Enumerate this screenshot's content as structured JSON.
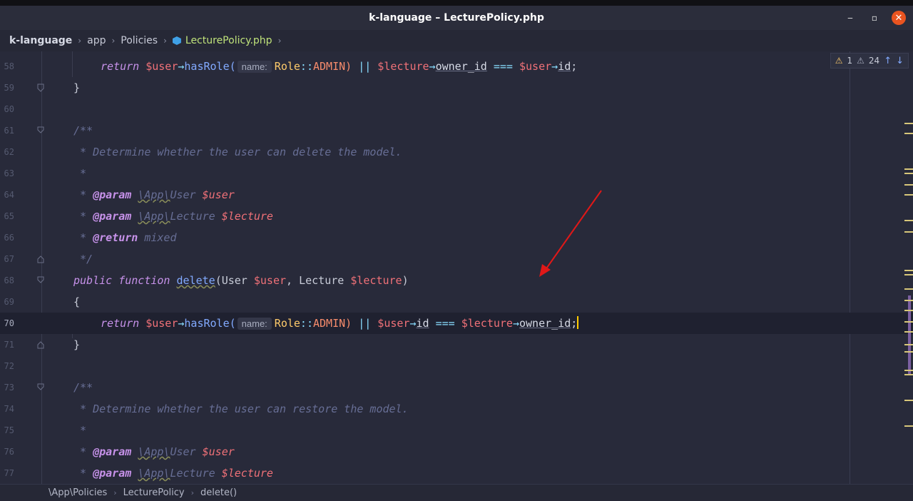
{
  "window": {
    "title": "k-language – LecturePolicy.php"
  },
  "nav": {
    "crumbs": [
      "k-language",
      "app",
      "Policies",
      "LecturePolicy.php"
    ],
    "separator": "›"
  },
  "inspections": {
    "errors": "1",
    "warnings": "24"
  },
  "editor": {
    "current_line": "70",
    "lines": [
      {
        "num": "58",
        "tokens": []
      },
      {
        "num": "59",
        "text": "}"
      },
      {
        "num": "60",
        "text": ""
      },
      {
        "num": "61",
        "text": "/**"
      },
      {
        "num": "62",
        "text": " * Determine whether the user can delete the model."
      },
      {
        "num": "63",
        "text": " *"
      },
      {
        "num": "64"
      },
      {
        "num": "65"
      },
      {
        "num": "66"
      },
      {
        "num": "67",
        "text": " */"
      },
      {
        "num": "68"
      },
      {
        "num": "69",
        "text": "{"
      },
      {
        "num": "70"
      },
      {
        "num": "71",
        "text": "}"
      },
      {
        "num": "72",
        "text": ""
      },
      {
        "num": "73",
        "text": "/**"
      },
      {
        "num": "74",
        "text": " * Determine whether the user can restore the model."
      },
      {
        "num": "75",
        "text": " *"
      },
      {
        "num": "76"
      },
      {
        "num": "77"
      }
    ],
    "tokens": {
      "return": "return",
      "user_var": "$user",
      "lecture_var": "$lecture",
      "arrow": "→",
      "hasRole": "hasRole(",
      "hint_name": "name:",
      "role": "Role",
      "dcolon": "::",
      "admin": "ADMIN)",
      "or": "||",
      "owner_id": "owner_id",
      "id": "id",
      "strict_eq": "===",
      "semicolon": ";",
      "param": "@param",
      "return_tag": "@return",
      "app_ns": "\\App\\",
      "user_cls": "User",
      "lecture_cls": "Lecture",
      "mixed": "mixed",
      "public": "public",
      "function": "function",
      "delete": "delete",
      "sig_open": "(User ",
      "sig_mid": ", Lecture ",
      "sig_close": ")",
      "comment_star": " * "
    }
  },
  "status": {
    "crumbs": [
      "\\App\\Policies",
      "LecturePolicy",
      "delete()"
    ],
    "separator": "›"
  },
  "colors": {
    "background": "#282a3a",
    "keyword": "#c792ea",
    "variable": "#f07178",
    "function": "#82aaff",
    "class": "#ffcb6b",
    "annotation_arrow": "#e01818"
  }
}
